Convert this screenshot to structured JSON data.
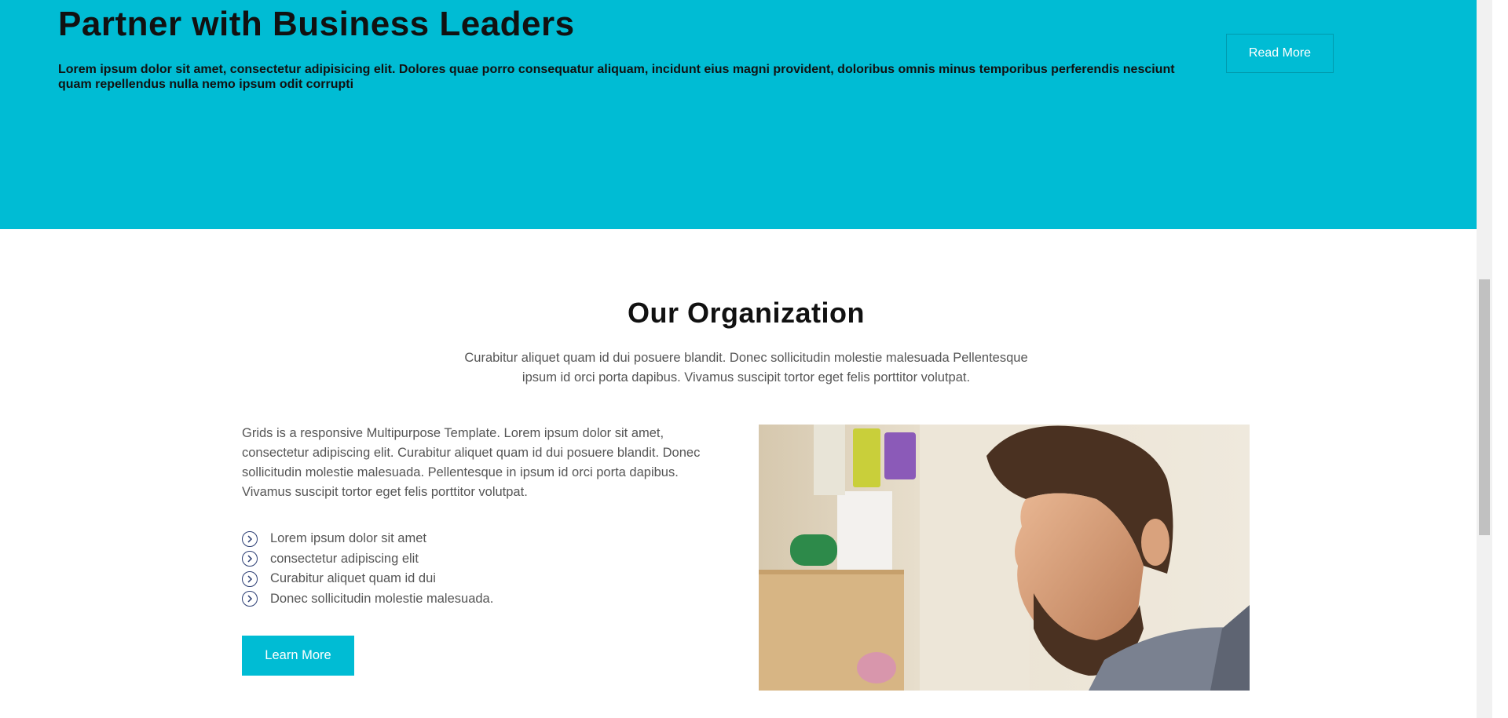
{
  "hero": {
    "title": "Partner with Business Leaders",
    "text": "Lorem ipsum dolor sit amet, consectetur adipisicing elit. Dolores quae porro consequatur aliquam, incidunt eius magni provident, doloribus omnis minus temporibus perferendis nesciunt quam repellendus nulla nemo ipsum odit corrupti",
    "button_label": "Read More",
    "background": "#00bcd4"
  },
  "organization": {
    "title": "Our Organization",
    "subtitle": "Curabitur aliquet quam id dui posuere blandit. Donec sollicitudin molestie malesuada Pellentesque ipsum id orci porta dapibus. Vivamus suscipit tortor eget felis porttitor volutpat.",
    "intro": "Grids is a responsive Multipurpose Template. Lorem ipsum dolor sit amet, consectetur adipiscing elit. Curabitur aliquet quam id dui posuere blandit. Donec sollicitudin molestie malesuada. Pellentesque in ipsum id orci porta dapibus. Vivamus suscipit tortor eget felis porttitor volutpat.",
    "features": [
      "Lorem ipsum dolor sit amet",
      "consectetur adipiscing elit",
      "Curabitur aliquet quam id dui",
      "Donec sollicitudin molestie malesuada."
    ],
    "button_label": "Learn More",
    "icon": "chevron-circle-right-icon",
    "accent": "#00bcd4"
  }
}
